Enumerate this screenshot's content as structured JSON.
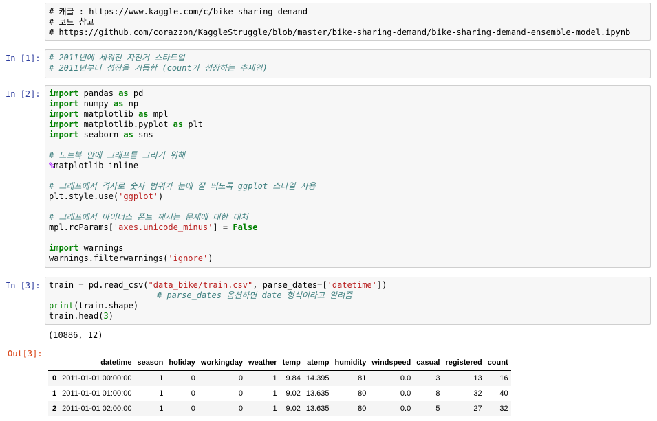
{
  "cells": {
    "markdown0": {
      "lines": [
        "# 캐글 : https://www.kaggle.com/c/bike-sharing-demand",
        "# 코드 참고",
        "# https://github.com/corazzon/KaggleStruggle/blob/master/bike-sharing-demand/bike-sharing-demand-ensemble-model.ipynb"
      ]
    },
    "in1": {
      "prompt": "In [1]:",
      "comments": [
        "# 2011년에 세워진 자전거 스타트업",
        "# 2011년부터 성장을 거듭함 (count가 성장하는 추세임)"
      ]
    },
    "in2": {
      "prompt": "In [2]:",
      "import_kw": "import",
      "as_kw": "as",
      "imports": [
        {
          "module": "pandas",
          "alias": "pd"
        },
        {
          "module": "numpy",
          "alias": "np"
        },
        {
          "module": "matplotlib",
          "alias": "mpl"
        },
        {
          "module": "matplotlib.pyplot",
          "alias": "plt"
        },
        {
          "module": "seaborn",
          "alias": "sns"
        }
      ],
      "comment_graph": "# 노트북 안에 그래프를 그리기 위해",
      "magic_pct": "%",
      "magic_rest": "matplotlib inline",
      "comment_grid": "# 그래프에서 격자로 숫자 범위가 눈에 잘 띄도록 ggplot 스타일 사용",
      "style_pre": "plt.style.use(",
      "style_str": "'ggplot'",
      "style_post": ")",
      "comment_minus": "# 그래프에서 마이너스 폰트 깨지는 문제에 대한 대처",
      "rc_pre": "mpl.rcParams[",
      "rc_str": "'axes.unicode_minus'",
      "rc_mid": "] ",
      "rc_eq": "=",
      "rc_false": "False",
      "warn_import_module": "warnings",
      "warn_pre": "warnings.filterwarnings(",
      "warn_str": "'ignore'",
      "warn_post": ")"
    },
    "in3": {
      "prompt": "In [3]:",
      "l1_a": "train ",
      "l1_eq": "=",
      "l1_b": " pd.read_csv(",
      "l1_str1": "\"data_bike/train.csv\"",
      "l1_c": ", parse_dates",
      "l1_eq2": "=",
      "l1_d": "[",
      "l1_str2": "'datetime'",
      "l1_e": "])",
      "l2_comment": "# parse_dates 옵션하면 date 형식이라고 알려줌",
      "l3_print": "print",
      "l3_rest": "(train.shape)",
      "l4_a": "train.head(",
      "l4_num": "3",
      "l4_b": ")",
      "stdout": "(10886, 12)"
    },
    "out3": {
      "prompt": "Out[3]:",
      "columns": [
        "datetime",
        "season",
        "holiday",
        "workingday",
        "weather",
        "temp",
        "atemp",
        "humidity",
        "windspeed",
        "casual",
        "registered",
        "count"
      ],
      "rows": [
        {
          "index": "0",
          "values": [
            "2011-01-01 00:00:00",
            "1",
            "0",
            "0",
            "1",
            "9.84",
            "14.395",
            "81",
            "0.0",
            "3",
            "13",
            "16"
          ]
        },
        {
          "index": "1",
          "values": [
            "2011-01-01 01:00:00",
            "1",
            "0",
            "0",
            "1",
            "9.02",
            "13.635",
            "80",
            "0.0",
            "8",
            "32",
            "40"
          ]
        },
        {
          "index": "2",
          "values": [
            "2011-01-01 02:00:00",
            "1",
            "0",
            "0",
            "1",
            "9.02",
            "13.635",
            "80",
            "0.0",
            "5",
            "27",
            "32"
          ]
        }
      ]
    }
  }
}
